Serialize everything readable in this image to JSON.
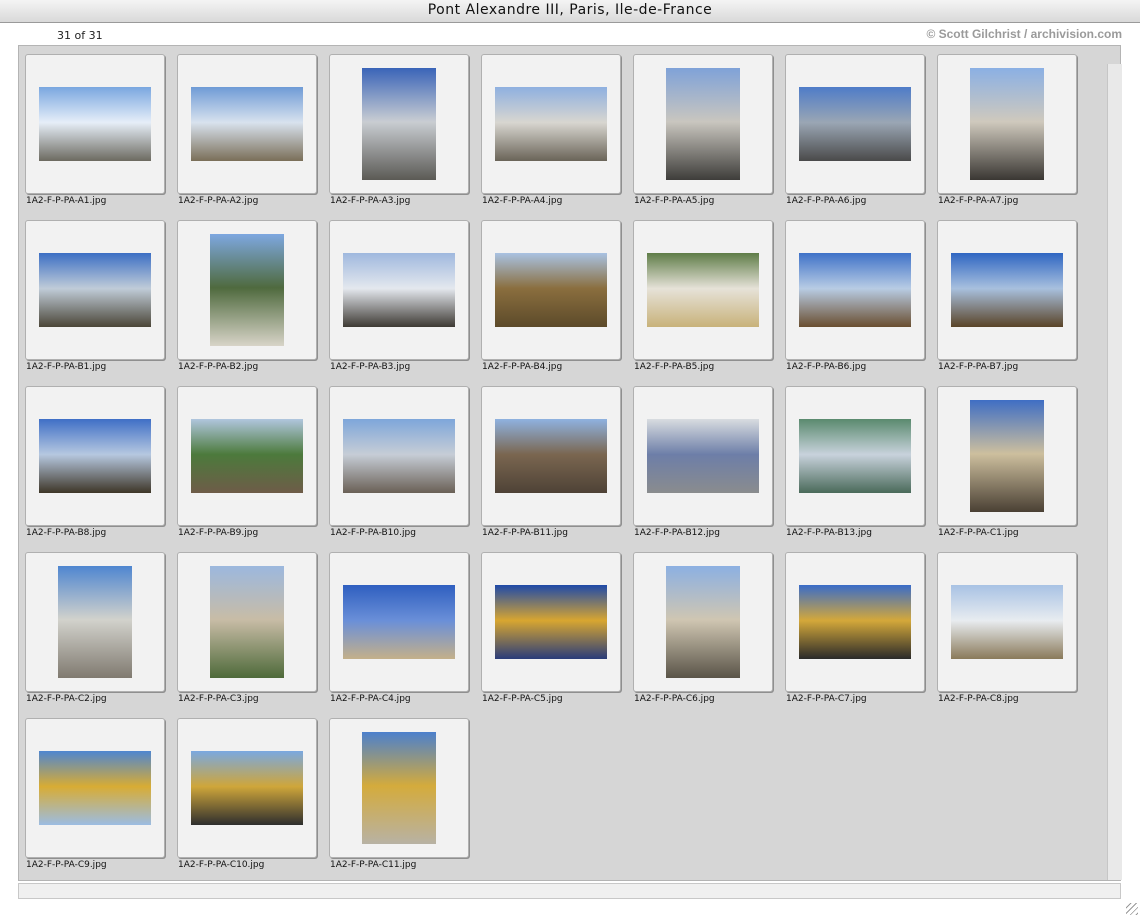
{
  "window": {
    "title": "Pont Alexandre III, Paris, Ile-de-France"
  },
  "counter": "31 of 31",
  "copyright": "© Scott Gilchrist / archivision.com",
  "grid": {
    "columns": 7,
    "thumbnails": [
      {
        "filename": "1A2-F-P-PA-A1.jpg",
        "orientation": "landscape",
        "palette": [
          "#7aa7e0",
          "#e6eef8",
          "#6c6a60"
        ]
      },
      {
        "filename": "1A2-F-P-PA-A2.jpg",
        "orientation": "landscape",
        "palette": [
          "#6f9bd6",
          "#d8e2ee",
          "#7a6e58"
        ]
      },
      {
        "filename": "1A2-F-P-PA-A3.jpg",
        "orientation": "portrait",
        "palette": [
          "#3a64b8",
          "#c9cdd2",
          "#5b5a55"
        ]
      },
      {
        "filename": "1A2-F-P-PA-A4.jpg",
        "orientation": "landscape",
        "palette": [
          "#8fb0e0",
          "#d8d6d0",
          "#6a6458"
        ]
      },
      {
        "filename": "1A2-F-P-PA-A5.jpg",
        "orientation": "portrait",
        "palette": [
          "#7fa2d8",
          "#c9c6bf",
          "#3e3d3a"
        ]
      },
      {
        "filename": "1A2-F-P-PA-A6.jpg",
        "orientation": "landscape",
        "palette": [
          "#4f7cc8",
          "#9aa6b4",
          "#4a4a4a"
        ]
      },
      {
        "filename": "1A2-F-P-PA-A7.jpg",
        "orientation": "portrait",
        "palette": [
          "#8bb0e4",
          "#cfc9bd",
          "#3a3733"
        ]
      },
      {
        "filename": "1A2-F-P-PA-B1.jpg",
        "orientation": "landscape",
        "palette": [
          "#3c6fc4",
          "#c0ccd8",
          "#4b4638"
        ]
      },
      {
        "filename": "1A2-F-P-PA-B2.jpg",
        "orientation": "portrait",
        "palette": [
          "#7ea8e0",
          "#4f6a3e",
          "#d8d4c8"
        ]
      },
      {
        "filename": "1A2-F-P-PA-B3.jpg",
        "orientation": "landscape",
        "palette": [
          "#9fb8de",
          "#e4e8ee",
          "#3e3a34"
        ]
      },
      {
        "filename": "1A2-F-P-PA-B4.jpg",
        "orientation": "landscape",
        "palette": [
          "#a9c2e2",
          "#8a6e3e",
          "#5c4a2a"
        ]
      },
      {
        "filename": "1A2-F-P-PA-B5.jpg",
        "orientation": "landscape",
        "palette": [
          "#5f7d48",
          "#e6e2d8",
          "#c8b27a"
        ]
      },
      {
        "filename": "1A2-F-P-PA-B6.jpg",
        "orientation": "landscape",
        "palette": [
          "#3f72c8",
          "#b8cce4",
          "#6a4e30"
        ]
      },
      {
        "filename": "1A2-F-P-PA-B7.jpg",
        "orientation": "landscape",
        "palette": [
          "#2f66c2",
          "#a8c0de",
          "#5a4428"
        ]
      },
      {
        "filename": "1A2-F-P-PA-B8.jpg",
        "orientation": "landscape",
        "palette": [
          "#3f6fc6",
          "#b6c8e0",
          "#3e3628"
        ]
      },
      {
        "filename": "1A2-F-P-PA-B9.jpg",
        "orientation": "landscape",
        "palette": [
          "#b0c6de",
          "#4c7a3c",
          "#6e5c48"
        ]
      },
      {
        "filename": "1A2-F-P-PA-B10.jpg",
        "orientation": "landscape",
        "palette": [
          "#7ea6da",
          "#c6cdd6",
          "#6a6056"
        ]
      },
      {
        "filename": "1A2-F-P-PA-B11.jpg",
        "orientation": "landscape",
        "palette": [
          "#8fb2e0",
          "#7a6650",
          "#4e4236"
        ]
      },
      {
        "filename": "1A2-F-P-PA-B12.jpg",
        "orientation": "landscape",
        "palette": [
          "#d8dce0",
          "#6d7ea8",
          "#8a8c8e"
        ]
      },
      {
        "filename": "1A2-F-P-PA-B13.jpg",
        "orientation": "landscape",
        "palette": [
          "#5a8a6e",
          "#c8d2dc",
          "#4a6a5a"
        ]
      },
      {
        "filename": "1A2-F-P-PA-C1.jpg",
        "orientation": "portrait",
        "palette": [
          "#3f6ec4",
          "#cdbf9e",
          "#4a4034"
        ]
      },
      {
        "filename": "1A2-F-P-PA-C2.jpg",
        "orientation": "portrait",
        "palette": [
          "#4f86d0",
          "#d2d2cc",
          "#807a70"
        ]
      },
      {
        "filename": "1A2-F-P-PA-C3.jpg",
        "orientation": "portrait",
        "palette": [
          "#9cb8de",
          "#c8bca6",
          "#4e6a3a"
        ]
      },
      {
        "filename": "1A2-F-P-PA-C4.jpg",
        "orientation": "landscape",
        "palette": [
          "#2f5fc0",
          "#6a8fd8",
          "#c4b08a"
        ]
      },
      {
        "filename": "1A2-F-P-PA-C5.jpg",
        "orientation": "landscape",
        "palette": [
          "#1f4aa8",
          "#d8a630",
          "#2a3c7a"
        ]
      },
      {
        "filename": "1A2-F-P-PA-C6.jpg",
        "orientation": "portrait",
        "palette": [
          "#8cb0e2",
          "#cfc6b2",
          "#5a5448"
        ]
      },
      {
        "filename": "1A2-F-P-PA-C7.jpg",
        "orientation": "landscape",
        "palette": [
          "#3a6cc8",
          "#d4a83a",
          "#2a2a2a"
        ]
      },
      {
        "filename": "1A2-F-P-PA-C8.jpg",
        "orientation": "landscape",
        "palette": [
          "#a8c2e4",
          "#e8ecf0",
          "#8a7a5a"
        ]
      },
      {
        "filename": "1A2-F-P-PA-C9.jpg",
        "orientation": "landscape",
        "palette": [
          "#4f86d0",
          "#d8ac34",
          "#9cbce2"
        ]
      },
      {
        "filename": "1A2-F-P-PA-C10.jpg",
        "orientation": "landscape",
        "palette": [
          "#7aa8e0",
          "#cfa63a",
          "#2e2e2e"
        ]
      },
      {
        "filename": "1A2-F-P-PA-C11.jpg",
        "orientation": "portrait",
        "palette": [
          "#4c80cc",
          "#d4ab3c",
          "#b8b2a4"
        ]
      }
    ]
  }
}
